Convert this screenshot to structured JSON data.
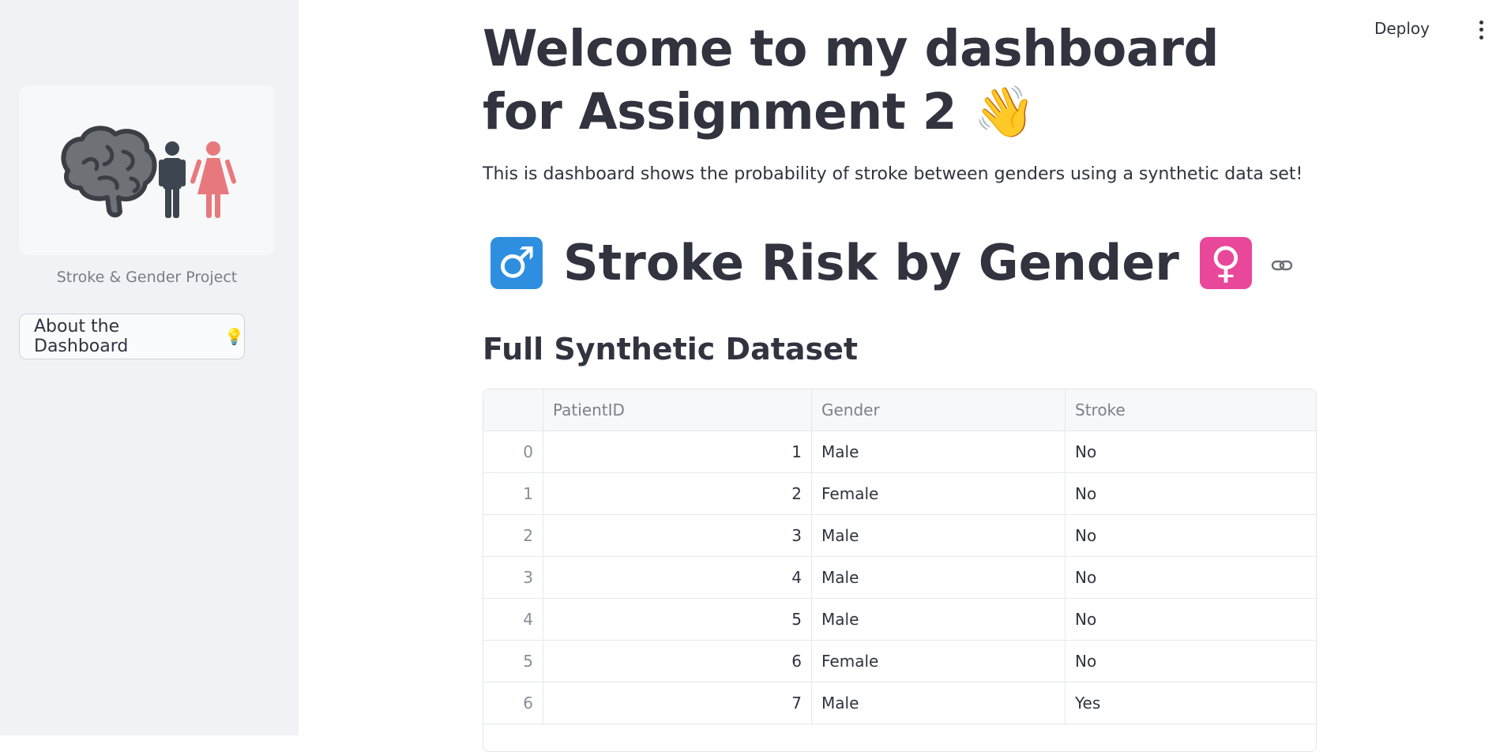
{
  "header": {
    "deploy_label": "Deploy"
  },
  "sidebar": {
    "caption": "Stroke & Gender Project",
    "about_button": {
      "label": "About the Dashboard",
      "emoji": "💡"
    }
  },
  "main": {
    "title": "Welcome to my dashboard for Assignment 2",
    "title_emoji": "👋",
    "intro": "This is dashboard shows the probability of stroke between genders using a synthetic data set!",
    "subheader": {
      "male_symbol": "♂",
      "text": "Stroke Risk by Gender",
      "female_symbol": "♀"
    },
    "section_title": "Full Synthetic Dataset",
    "table": {
      "columns": [
        "",
        "PatientID",
        "Gender",
        "Stroke"
      ],
      "rows": [
        [
          "0",
          "1",
          "Male",
          "No"
        ],
        [
          "1",
          "2",
          "Female",
          "No"
        ],
        [
          "2",
          "3",
          "Male",
          "No"
        ],
        [
          "3",
          "4",
          "Male",
          "No"
        ],
        [
          "4",
          "5",
          "Male",
          "No"
        ],
        [
          "5",
          "6",
          "Female",
          "No"
        ],
        [
          "6",
          "7",
          "Male",
          "Yes"
        ]
      ]
    }
  }
}
